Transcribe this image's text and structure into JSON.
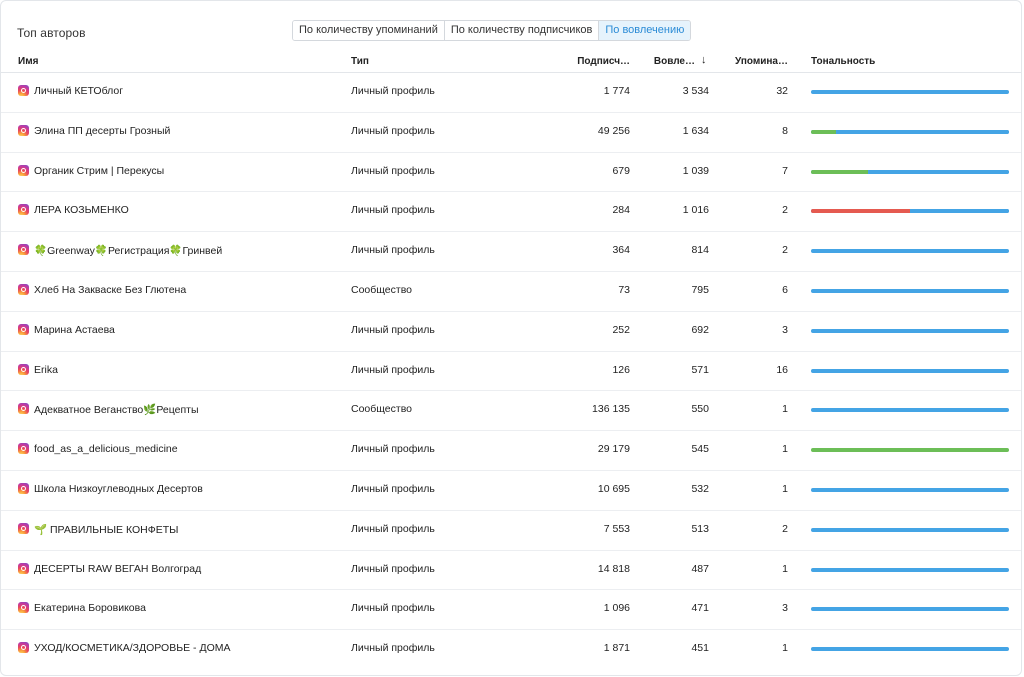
{
  "widget": {
    "title": "Топ авторов",
    "tabs": [
      {
        "label": "По количеству упоминаний",
        "active": false
      },
      {
        "label": "По количеству подписчиков",
        "active": false
      },
      {
        "label": "По вовлечению",
        "active": true
      }
    ]
  },
  "table": {
    "columns": {
      "name": "Имя",
      "type": "Тип",
      "subscribers": "Подписч…",
      "engagement": "Вовле…",
      "sort_arrow": "↓",
      "mentions": "Упомина…",
      "tone": "Тональность"
    },
    "rows": [
      {
        "name": "Личный КЕТОблог",
        "type": "Личный профиль",
        "subscribers": "1 774",
        "engagement": "3 534",
        "mentions": "32",
        "tone_positive": 0,
        "tone_negative": 0
      },
      {
        "name": "Элина ПП десерты Грозный",
        "type": "Личный профиль",
        "subscribers": "49 256",
        "engagement": "1 634",
        "mentions": "8",
        "tone_positive": 0.125,
        "tone_negative": 0
      },
      {
        "name": "Органик Стрим | Перекусы",
        "type": "Личный профиль",
        "subscribers": "679",
        "engagement": "1 039",
        "mentions": "7",
        "tone_positive": 0.286,
        "tone_negative": 0
      },
      {
        "name": "ЛЕРА КОЗЬМЕНКО",
        "type": "Личный профиль",
        "subscribers": "284",
        "engagement": "1 016",
        "mentions": "2",
        "tone_positive": 0,
        "tone_negative": 0.5
      },
      {
        "name": "🍀Greenway🍀Регистрация🍀Гринвей",
        "type": "Личный профиль",
        "subscribers": "364",
        "engagement": "814",
        "mentions": "2",
        "tone_positive": 0,
        "tone_negative": 0
      },
      {
        "name": "Хлеб На Закваске Без Глютена",
        "type": "Сообщество",
        "subscribers": "73",
        "engagement": "795",
        "mentions": "6",
        "tone_positive": 0,
        "tone_negative": 0
      },
      {
        "name": "Марина Астаева",
        "type": "Личный профиль",
        "subscribers": "252",
        "engagement": "692",
        "mentions": "3",
        "tone_positive": 0,
        "tone_negative": 0
      },
      {
        "name": "Erika",
        "type": "Личный профиль",
        "subscribers": "126",
        "engagement": "571",
        "mentions": "16",
        "tone_positive": 0,
        "tone_negative": 0
      },
      {
        "name": "Адекватное Веганство🌿Рецепты",
        "type": "Сообщество",
        "subscribers": "136 135",
        "engagement": "550",
        "mentions": "1",
        "tone_positive": 0,
        "tone_negative": 0
      },
      {
        "name": "food_as_a_delicious_medicine",
        "type": "Личный профиль",
        "subscribers": "29 179",
        "engagement": "545",
        "mentions": "1",
        "tone_positive": 1,
        "tone_negative": 0
      },
      {
        "name": "Школа Низкоуглеводных Десертов",
        "type": "Личный профиль",
        "subscribers": "10 695",
        "engagement": "532",
        "mentions": "1",
        "tone_positive": 0,
        "tone_negative": 0
      },
      {
        "name": "🌱 ПРАВИЛЬНЫЕ КОНФЕТЫ",
        "type": "Личный профиль",
        "subscribers": "7 553",
        "engagement": "513",
        "mentions": "2",
        "tone_positive": 0,
        "tone_negative": 0
      },
      {
        "name": "ДЕСЕРТЫ RAW ВЕГАН Волгоград",
        "type": "Личный профиль",
        "subscribers": "14 818",
        "engagement": "487",
        "mentions": "1",
        "tone_positive": 0,
        "tone_negative": 0
      },
      {
        "name": "Екатерина Боровикова",
        "type": "Личный профиль",
        "subscribers": "1 096",
        "engagement": "471",
        "mentions": "3",
        "tone_positive": 0,
        "tone_negative": 0
      },
      {
        "name": "УХОД/КОСМЕТИКА/ЗДОРОВЬЕ - ДОМА",
        "type": "Личный профиль",
        "subscribers": "1 871",
        "engagement": "451",
        "mentions": "1",
        "tone_positive": 0,
        "tone_negative": 0
      }
    ]
  },
  "icons": {
    "row_source": "instagram-icon"
  },
  "colors": {
    "accent": "#2a8bd6",
    "tone_positive": "#6cbe57",
    "tone_negative": "#e55a50",
    "tone_neutral": "#44a4e5"
  }
}
